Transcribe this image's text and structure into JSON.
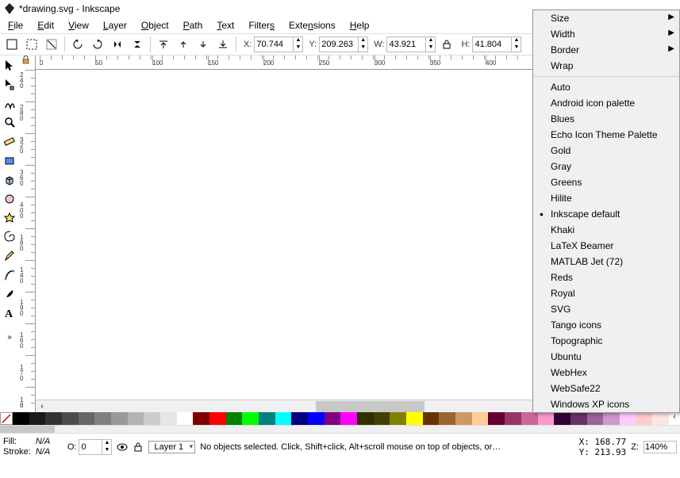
{
  "titlebar": {
    "title": "*drawing.svg - Inkscape"
  },
  "menu": {
    "items": [
      "File",
      "Edit",
      "View",
      "Layer",
      "Object",
      "Path",
      "Text",
      "Filters",
      "Extensions",
      "Help"
    ]
  },
  "toolbar": {
    "x_label": "X:",
    "x_value": "70.744",
    "y_label": "Y:",
    "y_value": "209.263",
    "w_label": "W:",
    "w_value": "43.921",
    "h_label": "H:",
    "h_value": "41.804"
  },
  "context_menu": {
    "top": [
      "Size",
      "Width",
      "Border",
      "Wrap"
    ],
    "items": [
      "Auto",
      "Android icon palette",
      "Blues",
      "Echo Icon Theme Palette",
      "Gold",
      "Gray",
      "Greens",
      "Hilite",
      "Inkscape default",
      "Khaki",
      "LaTeX Beamer",
      "MATLAB Jet (72)",
      "Reds",
      "Royal",
      "SVG",
      "Tango icons",
      "Topographic",
      "Ubuntu",
      "WebHex",
      "WebSafe22",
      "Windows XP icons"
    ],
    "selected": "Inkscape default"
  },
  "status": {
    "fill_label": "Fill:",
    "fill_value": "N/A",
    "stroke_label": "Stroke:",
    "stroke_value": "N/A",
    "opacity_label": "O:",
    "opacity_value": "0",
    "layer_label": "Layer 1",
    "message": "No objects selected. Click, Shift+click, Alt+scroll mouse on top of objects, or…",
    "x_label": "X:",
    "x_value": "168.77",
    "y_label": "Y:",
    "y_value": "213.93",
    "z_label": "Z:",
    "zoom": "140%"
  },
  "ruler_h_labels": [
    {
      "p": 5,
      "t": "0"
    },
    {
      "p": 75,
      "t": "50"
    },
    {
      "p": 147,
      "t": "100"
    },
    {
      "p": 217,
      "t": "150"
    },
    {
      "p": 287,
      "t": "200"
    },
    {
      "p": 357,
      "t": "250"
    },
    {
      "p": 427,
      "t": "300"
    },
    {
      "p": 497,
      "t": "350"
    },
    {
      "p": 567,
      "t": "400"
    }
  ],
  "ruler_v_labels": [
    {
      "p": 6,
      "t": "2"
    },
    {
      "p": 13,
      "t": "4"
    },
    {
      "p": 20,
      "t": "0"
    },
    {
      "p": 47,
      "t": "2"
    },
    {
      "p": 54,
      "t": "8"
    },
    {
      "p": 61,
      "t": "0"
    },
    {
      "p": 88,
      "t": "3"
    },
    {
      "p": 95,
      "t": "2"
    },
    {
      "p": 102,
      "t": "0"
    },
    {
      "p": 129,
      "t": "3"
    },
    {
      "p": 136,
      "t": "6"
    },
    {
      "p": 143,
      "t": "0"
    },
    {
      "p": 170,
      "t": "4"
    },
    {
      "p": 177,
      "t": "0"
    },
    {
      "p": 184,
      "t": "0"
    },
    {
      "p": 211,
      "t": "1"
    },
    {
      "p": 218,
      "t": "8"
    },
    {
      "p": 225,
      "t": "0"
    },
    {
      "p": 252,
      "t": "1"
    },
    {
      "p": 259,
      "t": "4"
    },
    {
      "p": 266,
      "t": "0"
    },
    {
      "p": 293,
      "t": "1"
    },
    {
      "p": 300,
      "t": "9"
    },
    {
      "p": 307,
      "t": "0"
    },
    {
      "p": 334,
      "t": "1"
    },
    {
      "p": 341,
      "t": "6"
    },
    {
      "p": 348,
      "t": "0"
    },
    {
      "p": 375,
      "t": "1"
    },
    {
      "p": 382,
      "t": "7"
    },
    {
      "p": 389,
      "t": "0"
    },
    {
      "p": 416,
      "t": "1"
    },
    {
      "p": 423,
      "t": "8"
    }
  ],
  "palette": [
    "#000000",
    "#1a1a1a",
    "#333333",
    "#4d4d4d",
    "#666666",
    "#808080",
    "#999999",
    "#b3b3b3",
    "#cccccc",
    "#e6e6e6",
    "#ffffff",
    "#800000",
    "#ff0000",
    "#008000",
    "#00ff00",
    "#008080",
    "#00ffff",
    "#000080",
    "#0000ff",
    "#800080",
    "#ff00ff",
    "#2f2f00",
    "#404000",
    "#808000",
    "#ffff00",
    "#663300",
    "#996633",
    "#cc9966",
    "#ffcc99",
    "#660033",
    "#993366",
    "#cc6699",
    "#ff99cc",
    "#330033",
    "#663366",
    "#996699",
    "#cc99cc",
    "#ffccff",
    "#ffcccc",
    "#ffe6e6"
  ]
}
